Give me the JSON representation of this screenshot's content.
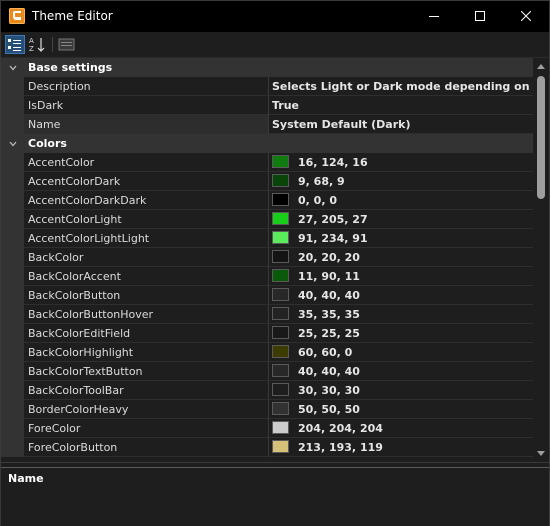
{
  "window": {
    "title": "Theme Editor"
  },
  "toolbar": {
    "categorized_icon": "categorized-icon",
    "alphabetical_icon": "alphabetical-icon",
    "property_pages_icon": "property-pages-icon"
  },
  "categories": [
    {
      "label": "Base settings",
      "properties": [
        {
          "name": "Description",
          "value": "Selects Light or Dark mode depending on the d"
        },
        {
          "name": "IsDark",
          "value": "True"
        },
        {
          "name": "Name",
          "value": "System Default (Dark)"
        }
      ]
    },
    {
      "label": "Colors",
      "properties": [
        {
          "name": "AccentColor",
          "value": "16, 124, 16",
          "color": "#107c10"
        },
        {
          "name": "AccentColorDark",
          "value": "9, 68, 9",
          "color": "#094409"
        },
        {
          "name": "AccentColorDarkDark",
          "value": "0, 0, 0",
          "color": "#000000"
        },
        {
          "name": "AccentColorLight",
          "value": "27, 205, 27",
          "color": "#1bcd1b"
        },
        {
          "name": "AccentColorLightLight",
          "value": "91, 234, 91",
          "color": "#5bea5b"
        },
        {
          "name": "BackColor",
          "value": "20, 20, 20",
          "color": "#141414"
        },
        {
          "name": "BackColorAccent",
          "value": "11, 90, 11",
          "color": "#0b5a0b"
        },
        {
          "name": "BackColorButton",
          "value": "40, 40, 40",
          "color": "#282828"
        },
        {
          "name": "BackColorButtonHover",
          "value": "35, 35, 35",
          "color": "#232323"
        },
        {
          "name": "BackColorEditField",
          "value": "25, 25, 25",
          "color": "#191919"
        },
        {
          "name": "BackColorHighlight",
          "value": "60, 60, 0",
          "color": "#3c3c00"
        },
        {
          "name": "BackColorTextButton",
          "value": "40, 40, 40",
          "color": "#282828"
        },
        {
          "name": "BackColorToolBar",
          "value": "30, 30, 30",
          "color": "#1e1e1e"
        },
        {
          "name": "BorderColorHeavy",
          "value": "50, 50, 50",
          "color": "#323232"
        },
        {
          "name": "ForeColor",
          "value": "204, 204, 204",
          "color": "#cccccc"
        },
        {
          "name": "ForeColorButton",
          "value": "213, 193, 119",
          "color": "#d5c177"
        }
      ]
    }
  ],
  "help": {
    "title": "Name"
  }
}
